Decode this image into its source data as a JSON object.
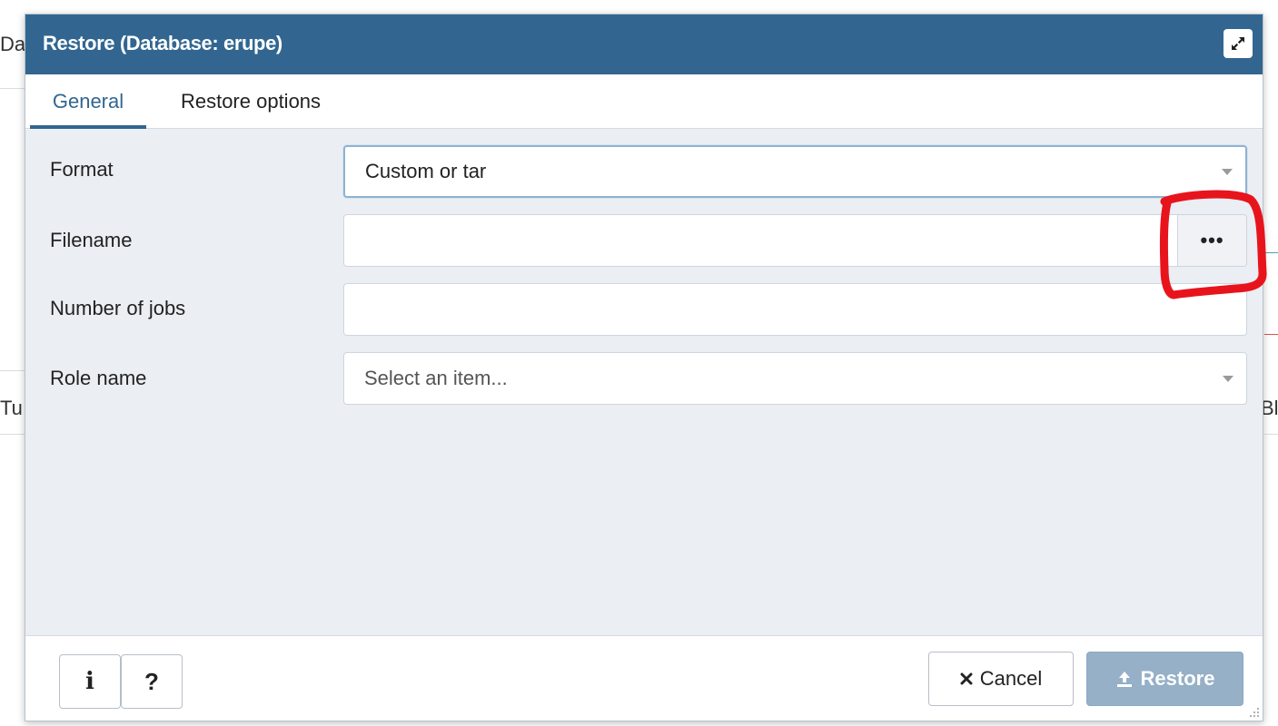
{
  "background": {
    "left_top_fragment": "Da",
    "left_mid_fragment": "Tu",
    "right_mid_fragment": "Bl"
  },
  "dialog": {
    "title": "Restore (Database: erupe)",
    "maximize_icon": "maximize-icon",
    "tabs": [
      {
        "label": "General",
        "active": true
      },
      {
        "label": "Restore options",
        "active": false
      }
    ],
    "fields": {
      "format": {
        "label": "Format",
        "value": "Custom or tar"
      },
      "filename": {
        "label": "Filename",
        "value": "",
        "browse_label": "•••"
      },
      "jobs": {
        "label": "Number of jobs",
        "value": ""
      },
      "role": {
        "label": "Role name",
        "placeholder": "Select an item..."
      }
    },
    "footer": {
      "info_label": "i",
      "help_label": "?",
      "cancel_label": "Cancel",
      "cancel_icon": "close-icon",
      "restore_label": "Restore",
      "restore_icon": "upload-icon"
    }
  },
  "colors": {
    "titlebar": "#326690",
    "accent": "#326690",
    "restore_button": "#95b0c7",
    "annotation": "#e8141c"
  }
}
